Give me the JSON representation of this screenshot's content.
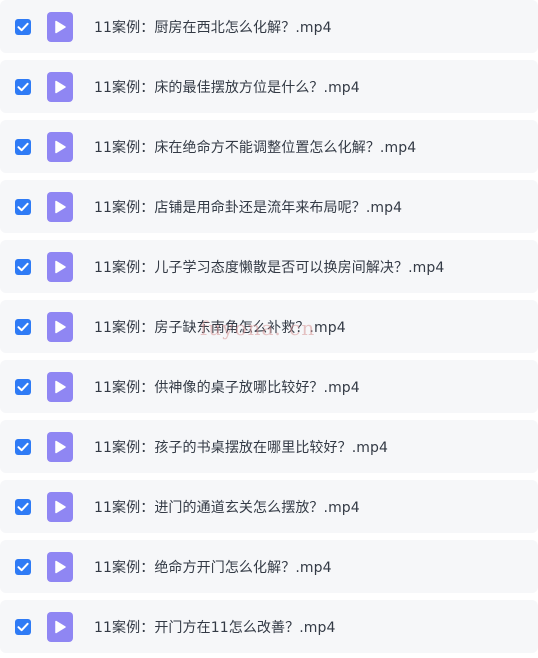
{
  "files": [
    {
      "name": "11案例：厨房在西北怎么化解？.mp4",
      "checked": true
    },
    {
      "name": "11案例：床的最佳摆放方位是什么？.mp4",
      "checked": true
    },
    {
      "name": "11案例：床在绝命方不能调整位置怎么化解？.mp4",
      "checked": true
    },
    {
      "name": "11案例：店铺是用命卦还是流年来布局呢？.mp4",
      "checked": true
    },
    {
      "name": "11案例：儿子学习态度懒散是否可以换房间解决？.mp4",
      "checked": true
    },
    {
      "name": "11案例：房子缺东南角怎么补救？.mp4",
      "checked": true
    },
    {
      "name": "11案例：供神像的桌子放哪比较好？.mp4",
      "checked": true
    },
    {
      "name": "11案例：孩子的书桌摆放在哪里比较好？.mp4",
      "checked": true
    },
    {
      "name": "11案例：进门的通道玄关怎么摆放？.mp4",
      "checked": true
    },
    {
      "name": "11案例：绝命方开门怎么化解？.mp4",
      "checked": true
    },
    {
      "name": "11案例：开门方在11怎么改善？.mp4",
      "checked": true
    }
  ],
  "watermark": "fuyona. cn",
  "colors": {
    "row_bg": "#f6f7f9",
    "checkbox": "#2f7bf5",
    "file_icon": "#8f86f3",
    "text": "#333a45"
  },
  "icons": {
    "checkbox": "checkmark-icon",
    "file": "video-play-icon"
  }
}
